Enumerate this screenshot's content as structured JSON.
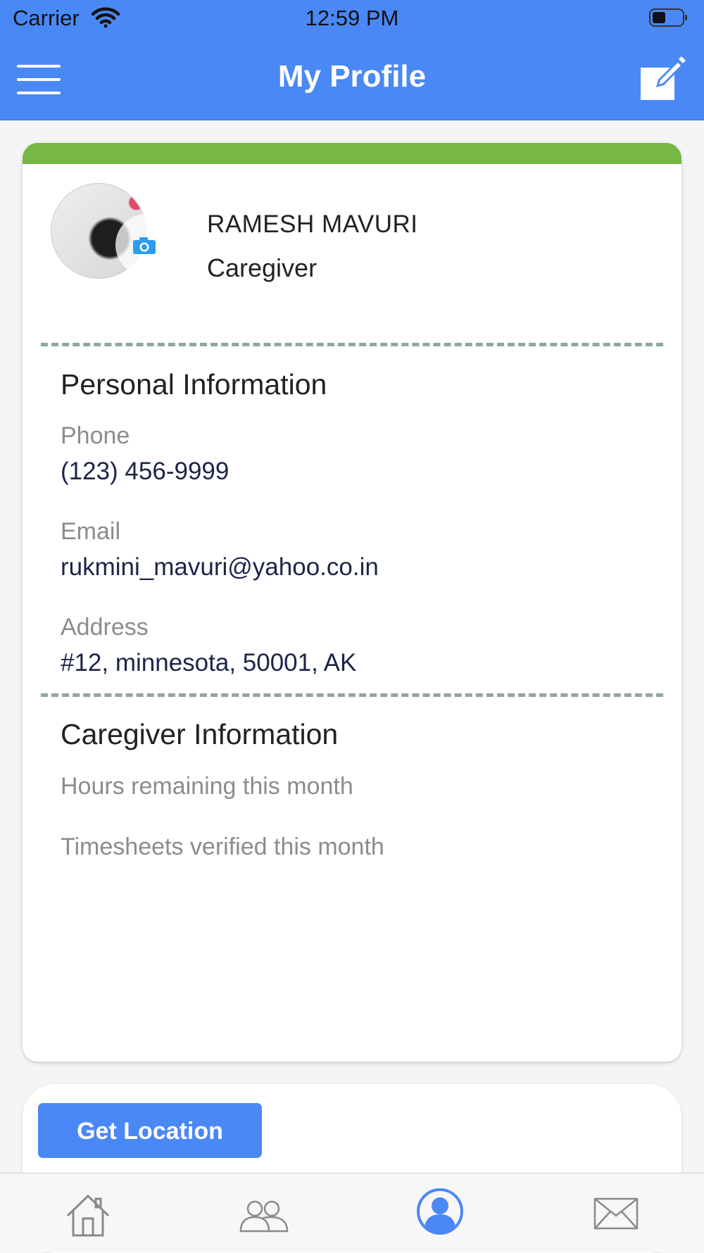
{
  "status_bar": {
    "carrier": "Carrier",
    "time": "12:59 PM"
  },
  "header": {
    "title": "My Profile"
  },
  "profile": {
    "name": "RAMESH MAVURI",
    "role": "Caregiver"
  },
  "personal_info": {
    "title": "Personal Information",
    "phone_label": "Phone",
    "phone": "(123) 456-9999",
    "email_label": "Email",
    "email": "rukmini_mavuri@yahoo.co.in",
    "address_label": "Address",
    "address": "#12, minnesota, 50001, AK"
  },
  "caregiver_info": {
    "title": "Caregiver Information",
    "hours_label": "Hours remaining this month",
    "timesheets_label": "Timesheets verified this month"
  },
  "location": {
    "button_label": "Get Location"
  },
  "tabs": [
    {
      "icon": "home-icon",
      "active": false
    },
    {
      "icon": "people-icon",
      "active": false
    },
    {
      "icon": "profile-icon",
      "active": true
    },
    {
      "icon": "mail-icon",
      "active": false
    }
  ],
  "colors": {
    "primary": "#4a88f5",
    "accent_green": "#76b843",
    "value_text": "#1c2548",
    "label_text": "#8c8c8c"
  }
}
